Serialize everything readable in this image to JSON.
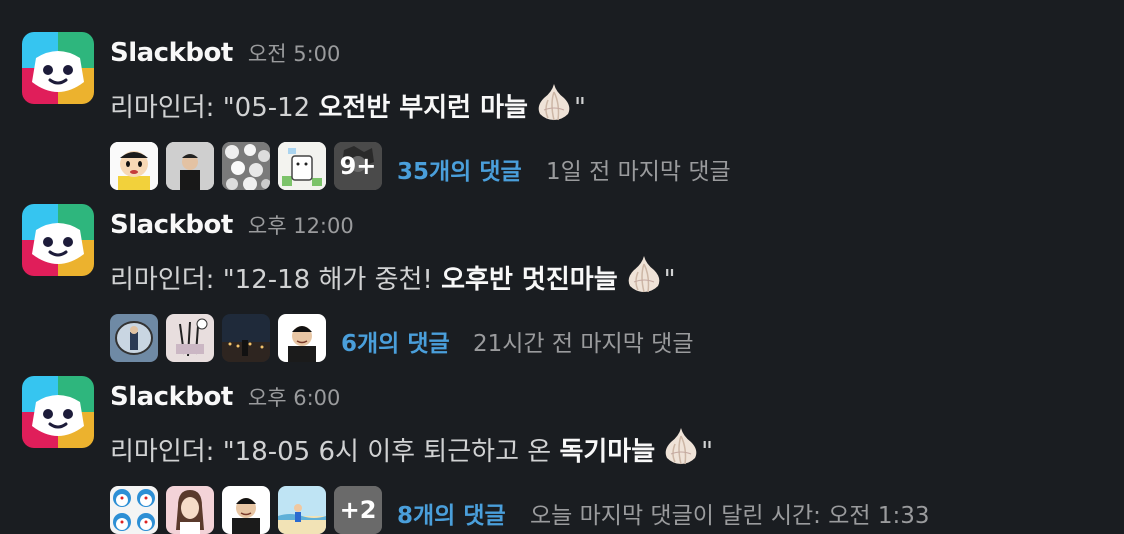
{
  "colors": {
    "background": "#1a1d21",
    "link": "#4a9fdb",
    "muted": "#9a9b9d"
  },
  "messages": [
    {
      "sender": "Slackbot",
      "time": "오전 5:00",
      "text_prefix": "리마인더: \"05-12 ",
      "text_bold": "오전반 부지런 마늘",
      "text_suffix": "\"",
      "emoji": "garlic-emoji",
      "participants": [
        "shinchan-avatar",
        "man-in-black-avatar",
        "flowers-avatar",
        "cartoon-sticker-avatar"
      ],
      "more_count": "9+",
      "reply_count": "35개의 댓글",
      "last_reply": "1일 전 마지막 댓글"
    },
    {
      "sender": "Slackbot",
      "time": "오후 12:00",
      "text_prefix": "리마인더: \"12-18 해가 중천! ",
      "text_bold": "오후반 멋진마늘",
      "text_suffix": "\"",
      "emoji": "garlic-emoji",
      "participants": [
        "mirror-photo-avatar",
        "drawing-avatar",
        "night-city-avatar",
        "man-smiling-avatar"
      ],
      "more_count": "",
      "reply_count": "6개의 댓글",
      "last_reply": "21시간 전 마지막 댓글"
    },
    {
      "sender": "Slackbot",
      "time": "오후 6:00",
      "text_prefix": "리마인더: \"18-05 6시 이후 퇴근하고 온 ",
      "text_bold": "독기마늘",
      "text_suffix": "\"",
      "emoji": "garlic-emoji",
      "participants": [
        "doraemon-avatar",
        "woman-avatar",
        "man-smiling-avatar",
        "beach-illustration-avatar"
      ],
      "more_count": "+2",
      "reply_count": "8개의 댓글",
      "last_reply": "오늘 마지막 댓글이 달린 시간: 오전 1:33"
    }
  ]
}
